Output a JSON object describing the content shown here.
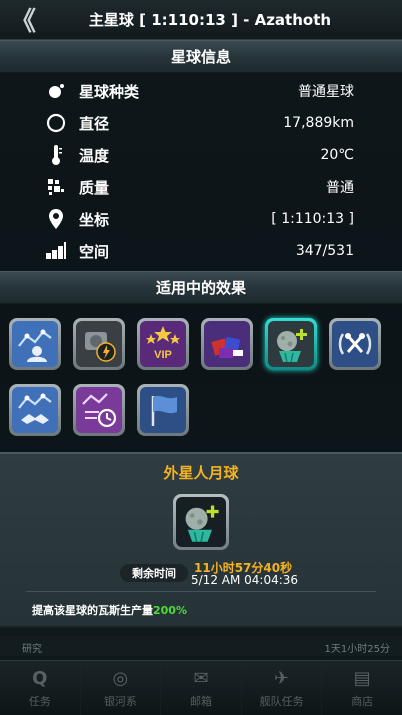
{
  "header": {
    "back_glyph": "《",
    "title": "主星球 [ 1:110:13 ] - Azathoth"
  },
  "planet_info": {
    "section_title": "星球信息",
    "rows": [
      {
        "label": "星球种类",
        "value": "普通星球",
        "icon": "planet-type-icon"
      },
      {
        "label": "直径",
        "value": "17,889km",
        "icon": "diameter-icon"
      },
      {
        "label": "温度",
        "value": "20℃",
        "icon": "thermometer-icon"
      },
      {
        "label": "质量",
        "value": "普通",
        "icon": "mass-icon"
      },
      {
        "label": "坐标",
        "value": "[ 1:110:13 ]",
        "icon": "location-pin-icon"
      },
      {
        "label": "空间",
        "value": "347/531",
        "icon": "space-icon"
      }
    ]
  },
  "effects": {
    "section_title": "适用中的效果",
    "vip_label": "VIP",
    "items": [
      {
        "name": "graph-user-icon",
        "selected": false
      },
      {
        "name": "gear-lightning-icon",
        "selected": false
      },
      {
        "name": "vip-stars-icon",
        "selected": false
      },
      {
        "name": "gift-boxes-icon",
        "selected": false
      },
      {
        "name": "alien-moon-icon",
        "selected": true
      },
      {
        "name": "crossed-wrenches-laurel-icon",
        "selected": false
      },
      {
        "name": "graph-handshake-icon",
        "selected": false
      },
      {
        "name": "graph-clock-icon",
        "selected": false
      },
      {
        "name": "flag-icon",
        "selected": false
      }
    ]
  },
  "popup": {
    "title": "外星人月球",
    "remaining_label": "剩余时间",
    "timer": "11小时57分40秒",
    "end_time": "5/12 AM 04:04:36",
    "description_prefix": "提高该星球的瓦斯生产量",
    "description_value": "200%"
  },
  "background": {
    "left_text": "研究",
    "right_text": "1天1小时25分"
  },
  "bottom_nav": {
    "items": [
      {
        "label": "任务",
        "icon_glyph": "Q"
      },
      {
        "label": "银河系",
        "icon_glyph": "◎"
      },
      {
        "label": "邮箱",
        "icon_glyph": "✉"
      },
      {
        "label": "舰队任务",
        "icon_glyph": "✈"
      },
      {
        "label": "商店",
        "icon_glyph": "▤"
      }
    ]
  },
  "colors": {
    "accent_orange": "#f5b322",
    "accent_green": "#4fdc3a",
    "selected_teal": "#26d6c9"
  }
}
